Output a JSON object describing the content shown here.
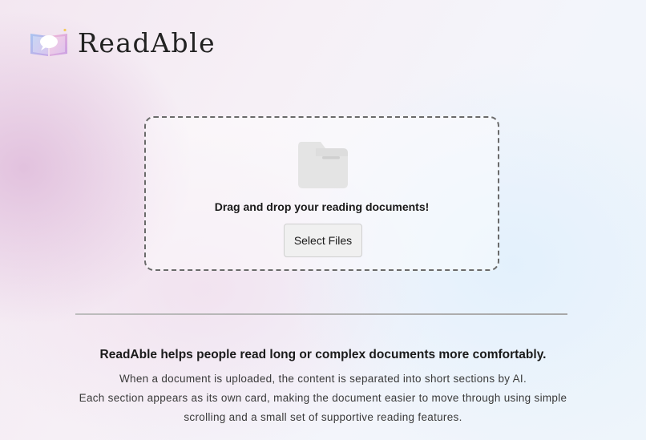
{
  "brand": {
    "name": "ReadAble",
    "icon": "open-book-chat-icon"
  },
  "upload": {
    "icon": "folder-icon",
    "prompt": "Drag and drop your reading documents!",
    "button_label": "Select Files"
  },
  "description": {
    "headline": "ReadAble helps people read long or complex documents more comfortably.",
    "lines": [
      "When a document is uploaded, the content is separated into short sections by AI.",
      "Each section appears as its own card, making the document easier to move through using simple",
      "scrolling and a small set of supportive reading features."
    ]
  },
  "colors": {
    "dropzone_border": "#6a6a6a",
    "button_bg": "#f0f0f0",
    "folder_icon": "#e2e2e2"
  }
}
